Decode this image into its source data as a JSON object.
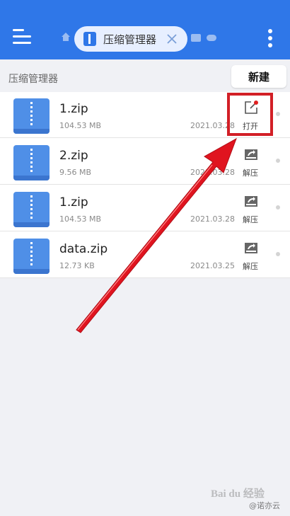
{
  "header": {
    "tab_label": "压缩管理器",
    "icons": [
      "menu-icon",
      "home-icon",
      "archive-app-icon",
      "close-icon",
      "chat-icon",
      "cloud-icon",
      "more-vertical-icon"
    ]
  },
  "breadcrumb": "压缩管理器",
  "new_button": "新建",
  "files": [
    {
      "name": "1.zip",
      "size": "104.53 MB",
      "date": "2021.03.28",
      "action": "打开",
      "action_icon": "open-icon"
    },
    {
      "name": "2.zip",
      "size": "9.56 MB",
      "date": "2021.03.28",
      "action": "解压",
      "action_icon": "extract-icon"
    },
    {
      "name": "1.zip",
      "size": "104.53 MB",
      "date": "2021.03.28",
      "action": "解压",
      "action_icon": "extract-icon"
    },
    {
      "name": "data.zip",
      "size": "12.73 KB",
      "date": "2021.03.25",
      "action": "解压",
      "action_icon": "extract-icon"
    }
  ],
  "watermark": {
    "logo": "Bai du 经验",
    "source": "@诺亦云"
  },
  "colors": {
    "header": "#2f77e8",
    "annotation": "#d21f26",
    "icon_blue": "#4f8fe7",
    "background": "#f0f1f5"
  }
}
